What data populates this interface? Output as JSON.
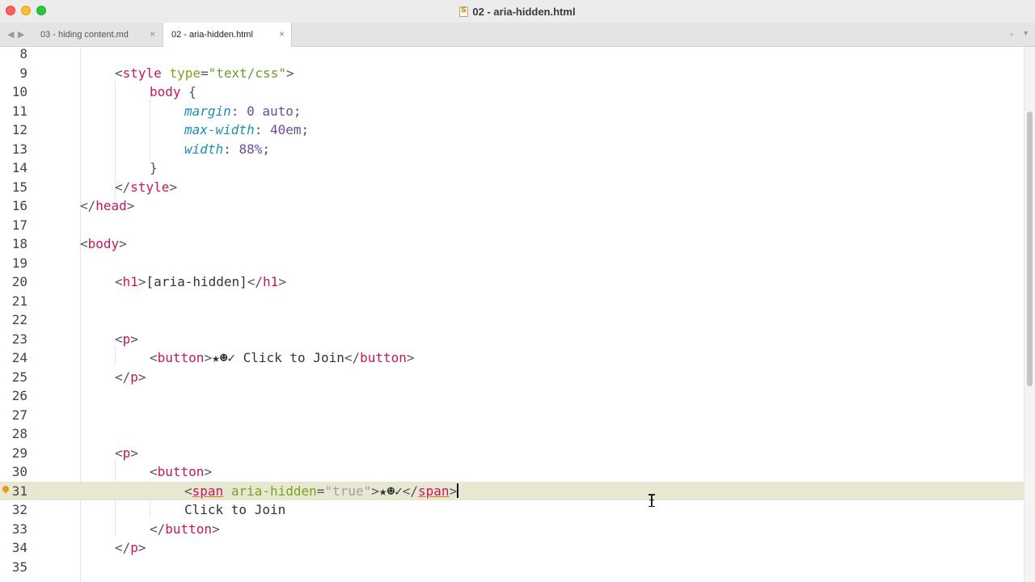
{
  "window": {
    "title": "02 - aria-hidden.html"
  },
  "tabs": [
    {
      "label": "03 - hiding content.md",
      "active": false
    },
    {
      "label": "02 - aria-hidden.html",
      "active": true
    }
  ],
  "tab_close_glyph": "×",
  "tab_add_glyph": "+",
  "tab_menu_glyph": "▼",
  "nav_back_glyph": "◀",
  "nav_forward_glyph": "▶",
  "editor": {
    "current_line": 31,
    "bookmarked_line": 31,
    "line_numbers": [
      "8",
      "9",
      "10",
      "11",
      "12",
      "13",
      "14",
      "15",
      "16",
      "17",
      "18",
      "19",
      "20",
      "21",
      "22",
      "23",
      "24",
      "25",
      "26",
      "27",
      "28",
      "29",
      "30",
      "31",
      "32",
      "33",
      "34",
      "35"
    ]
  },
  "code_text": {
    "l9_open": "<",
    "l9_tag": "style",
    "l9_attr": "type",
    "l9_eq": "=",
    "l9_val": "\"text/css\"",
    "l9_close": ">",
    "l10_sel": "body",
    "l10_brace": " {",
    "l11_prop": "margin",
    "l11_rest": ": ",
    "l11_val": "0 auto",
    "l11_semi": ";",
    "l12_prop": "max-width",
    "l12_rest": ": ",
    "l12_val": "40em",
    "l12_semi": ";",
    "l13_prop": "width",
    "l13_rest": ": ",
    "l13_val": "88%",
    "l13_semi": ";",
    "l14": "}",
    "l15_open": "</",
    "l15_tag": "style",
    "l15_close": ">",
    "l16_open": "</",
    "l16_tag": "head",
    "l16_close": ">",
    "l18_open": "<",
    "l18_tag": "body",
    "l18_close": ">",
    "l20_open": "<",
    "l20_tag": "h1",
    "l20_gt": ">",
    "l20_text": "[aria-hidden]",
    "l20_open2": "</",
    "l20_tag2": "h1",
    "l20_close": ">",
    "l23_open": "<",
    "l23_tag": "p",
    "l23_close": ">",
    "l24_open": "<",
    "l24_tag": "button",
    "l24_gt": ">",
    "l24_text": "★☻✓ Click to Join",
    "l24_open2": "</",
    "l24_tag2": "button",
    "l24_close": ">",
    "l25_open": "</",
    "l25_tag": "p",
    "l25_close": ">",
    "l29_open": "<",
    "l29_tag": "p",
    "l29_close": ">",
    "l30_open": "<",
    "l30_tag": "button",
    "l30_close": ">",
    "l31_open": "<",
    "l31_tag": "span",
    "l31_sp": " ",
    "l31_attr": "aria-hidden",
    "l31_eq": "=",
    "l31_val": "\"true\"",
    "l31_gt": ">",
    "l31_text": "★☻✓",
    "l31_open2": "</",
    "l31_tag2": "span",
    "l31_close": ">",
    "l32_text": "Click to Join",
    "l33_open": "</",
    "l33_tag": "button",
    "l33_close": ">",
    "l34_open": "</",
    "l34_tag": "p",
    "l34_close": ">"
  },
  "colors": {
    "tag": "#c2185b",
    "attribute": "#7aa21e",
    "property": "#1a8fb0",
    "number": "#6a4c9c",
    "current_line": "#e8e8d2",
    "bookmark": "#e89a1a"
  }
}
